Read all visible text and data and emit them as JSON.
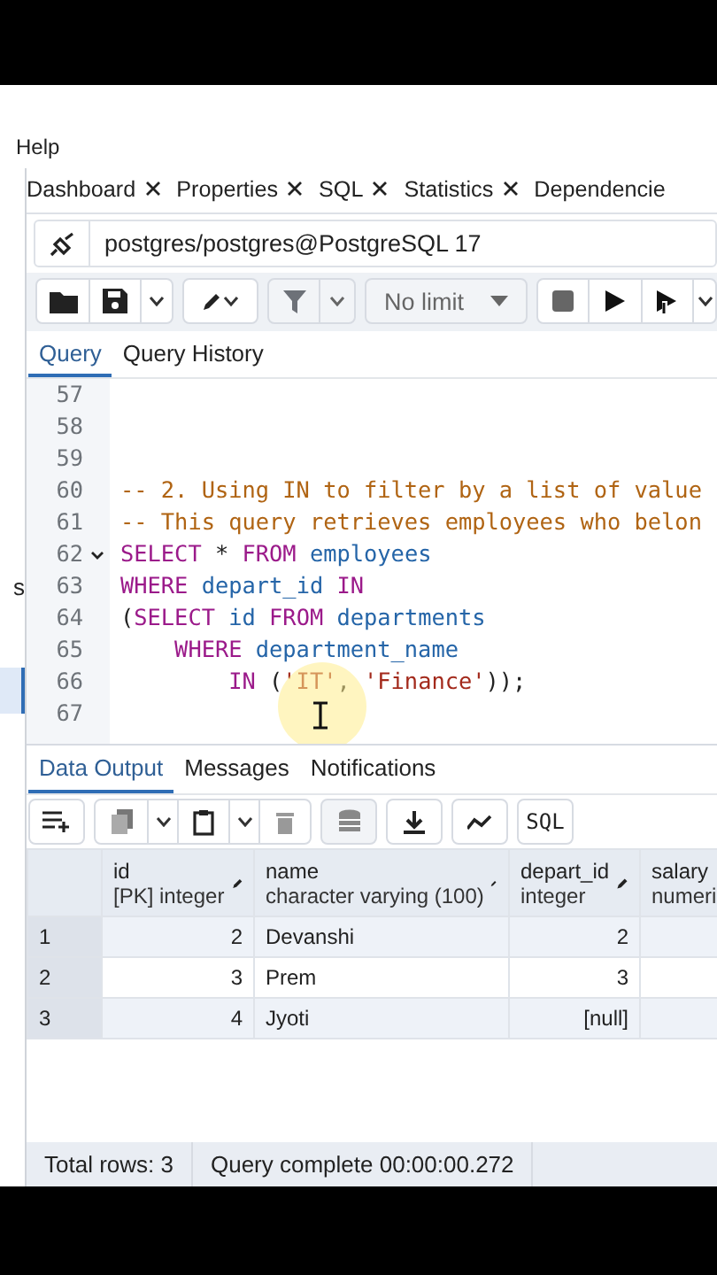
{
  "menu": {
    "items": [
      "Help"
    ]
  },
  "sidebar": {
    "items": [
      {
        "label": "s",
        "selected": false
      },
      {
        "selected": true
      }
    ]
  },
  "editor_tabs": [
    {
      "label": "Dashboard",
      "selected": false,
      "closable": true
    },
    {
      "label": "Properties",
      "selected": false,
      "closable": true
    },
    {
      "label": "SQL",
      "selected": false,
      "closable": true
    },
    {
      "label": "Statistics",
      "selected": false,
      "closable": true
    },
    {
      "label": "Dependencie",
      "selected": false,
      "closable": false
    }
  ],
  "connection": {
    "label": "postgres/postgres@PostgreSQL 17"
  },
  "toolbar": {
    "limit": "No limit"
  },
  "query_tabs": [
    {
      "label": "Query",
      "selected": true
    },
    {
      "label": "Query History",
      "selected": false
    }
  ],
  "editor": {
    "lines": [
      {
        "number": "57",
        "foldable": false
      },
      {
        "number": "58",
        "foldable": false
      },
      {
        "number": "59",
        "foldable": false
      },
      {
        "number": "60",
        "foldable": false,
        "tokens": [
          {
            "kind": "comment",
            "text": "-- 2. Using IN to filter by a list of value"
          }
        ]
      },
      {
        "number": "61",
        "foldable": false,
        "tokens": [
          {
            "kind": "comment",
            "text": "-- This query retrieves employees who belon"
          }
        ]
      },
      {
        "number": "62",
        "foldable": true,
        "tokens": [
          {
            "kind": "keyword",
            "text": "SELECT "
          },
          {
            "kind": "plain",
            "text": "* "
          },
          {
            "kind": "keyword",
            "text": "FROM "
          },
          {
            "kind": "name",
            "text": "employees"
          }
        ]
      },
      {
        "number": "63",
        "foldable": false,
        "tokens": [
          {
            "kind": "keyword",
            "text": "WHERE "
          },
          {
            "kind": "name",
            "text": "depart_id "
          },
          {
            "kind": "keyword",
            "text": "IN"
          }
        ]
      },
      {
        "number": "64",
        "foldable": false,
        "tokens": [
          {
            "kind": "plain",
            "text": "("
          },
          {
            "kind": "keyword",
            "text": "SELECT "
          },
          {
            "kind": "name",
            "text": "id "
          },
          {
            "kind": "keyword",
            "text": "FROM "
          },
          {
            "kind": "name",
            "text": "departments"
          }
        ]
      },
      {
        "number": "65",
        "foldable": false,
        "tokens": [
          {
            "kind": "keyword",
            "text": "    WHERE "
          },
          {
            "kind": "name",
            "text": "department_name"
          }
        ]
      },
      {
        "number": "66",
        "foldable": false,
        "tokens": [
          {
            "kind": "keyword",
            "text": "        IN "
          },
          {
            "kind": "plain",
            "text": "("
          },
          {
            "kind": "string",
            "text": "'IT'"
          },
          {
            "kind": "plain",
            "text": ", "
          },
          {
            "kind": "string",
            "text": "'Finance'"
          },
          {
            "kind": "plain",
            "text": "));"
          }
        ]
      },
      {
        "number": "67",
        "foldable": false
      }
    ]
  },
  "result_tabs": [
    {
      "label": "Data Output",
      "selected": true
    },
    {
      "label": "Messages",
      "selected": false
    },
    {
      "label": "Notifications",
      "selected": false
    }
  ],
  "result_toolbar": {
    "sql_button": "SQL"
  },
  "table": {
    "columns": [
      {
        "name": "id",
        "type": "[PK] integer"
      },
      {
        "name": "name",
        "type": "character varying (100)"
      },
      {
        "name": "depart_id",
        "type": "integer"
      },
      {
        "name": "salary",
        "type": "numeri"
      }
    ],
    "rows": [
      {
        "number": "1",
        "cells": [
          "2",
          "Devanshi",
          "2",
          ""
        ]
      },
      {
        "number": "2",
        "cells": [
          "3",
          "Prem",
          "3",
          ""
        ]
      },
      {
        "number": "3",
        "cells": [
          "4",
          "Jyoti",
          "[null]",
          ""
        ]
      }
    ]
  },
  "status_bar": {
    "total_rows": "Total rows: 3",
    "query_status": "Query complete 00:00:00.272"
  }
}
